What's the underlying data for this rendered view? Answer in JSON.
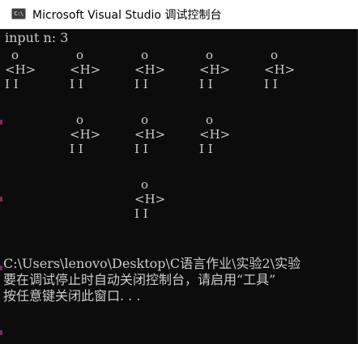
{
  "window": {
    "title": "Microsoft Visual Studio 调试控制台",
    "icon_text": "C:\\",
    "icon_name": "console-app-icon"
  },
  "console": {
    "prompt_line": "input n: 3",
    "figure_parts": {
      "head": "o",
      "body": "<H>",
      "legs": "I I"
    },
    "rows": [
      {
        "count": 5
      },
      {
        "count": 3
      },
      {
        "count": 1
      }
    ],
    "footer_lines": [
      "C:\\Users\\lenovo\\Desktop\\C语言作业\\实验2\\实验",
      "要在调试停止时自动关闭控制台，请启用“工具”",
      "按任意键关闭此窗口. . ."
    ]
  },
  "colors": {
    "console_bg": "#0c0c0c",
    "console_text": "#cccccc",
    "titlebar_bg": "#ffffff"
  }
}
